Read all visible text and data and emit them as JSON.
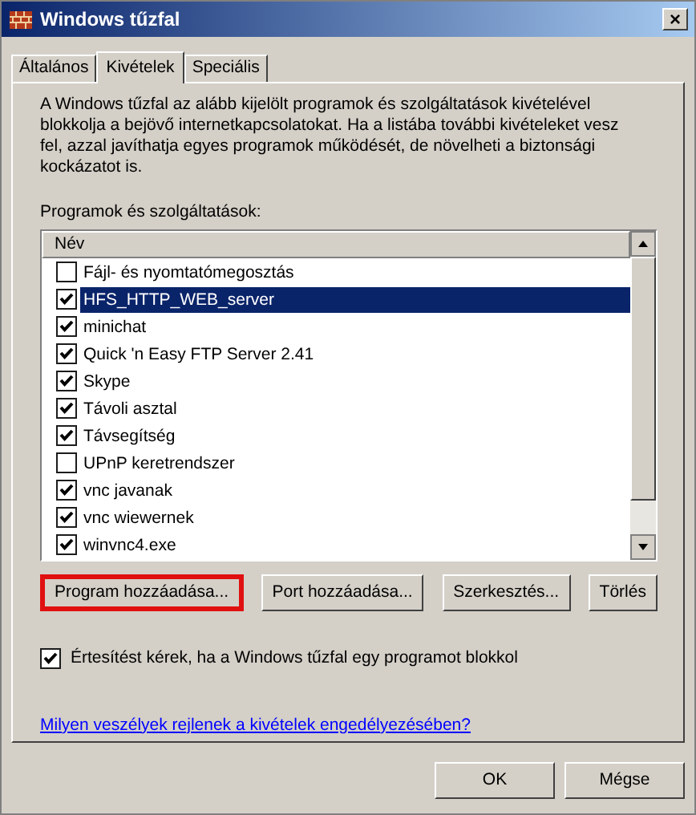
{
  "window": {
    "title": "Windows tűzfal",
    "close": "×"
  },
  "tabs": [
    {
      "label": "Általános",
      "selected": false
    },
    {
      "label": "Kivételek",
      "selected": true
    },
    {
      "label": "Speciális",
      "selected": false
    }
  ],
  "description": "A Windows tűzfal az alább kijelölt programok és szolgáltatások kivételével blokkolja a bejövő internetkapcsolatokat. Ha a listába további kivételeket vesz fel, azzal javíthatja egyes programok működését, de növelheti a biztonsági kockázatot is.",
  "list_label": "Programok és szolgáltatások:",
  "list": {
    "column": "Név",
    "items": [
      {
        "name": "Fájl- és nyomtatómegosztás",
        "checked": false,
        "selected": false
      },
      {
        "name": "HFS_HTTP_WEB_server",
        "checked": true,
        "selected": true
      },
      {
        "name": "minichat",
        "checked": true,
        "selected": false
      },
      {
        "name": "Quick 'n Easy FTP Server 2.41",
        "checked": true,
        "selected": false
      },
      {
        "name": "Skype",
        "checked": true,
        "selected": false
      },
      {
        "name": "Távoli asztal",
        "checked": true,
        "selected": false
      },
      {
        "name": "Távsegítség",
        "checked": true,
        "selected": false
      },
      {
        "name": "UPnP keretrendszer",
        "checked": false,
        "selected": false
      },
      {
        "name": "vnc javanak",
        "checked": true,
        "selected": false
      },
      {
        "name": "vnc wiewernek",
        "checked": true,
        "selected": false
      },
      {
        "name": "winvnc4.exe",
        "checked": true,
        "selected": false
      }
    ]
  },
  "buttons": [
    {
      "label": "Program hozzáadása...",
      "highlighted": true
    },
    {
      "label": "Port hozzáadása...",
      "highlighted": false
    },
    {
      "label": "Szerkesztés...",
      "highlighted": false
    },
    {
      "label": "Törlés",
      "highlighted": false
    }
  ],
  "notify": {
    "label": "Értesítést kérek, ha a Windows tűzfal egy programot blokkol",
    "checked": true
  },
  "link": "Milyen veszélyek rejlenek a kivételek engedélyezésében?",
  "footer_buttons": [
    "OK",
    "Mégse"
  ]
}
